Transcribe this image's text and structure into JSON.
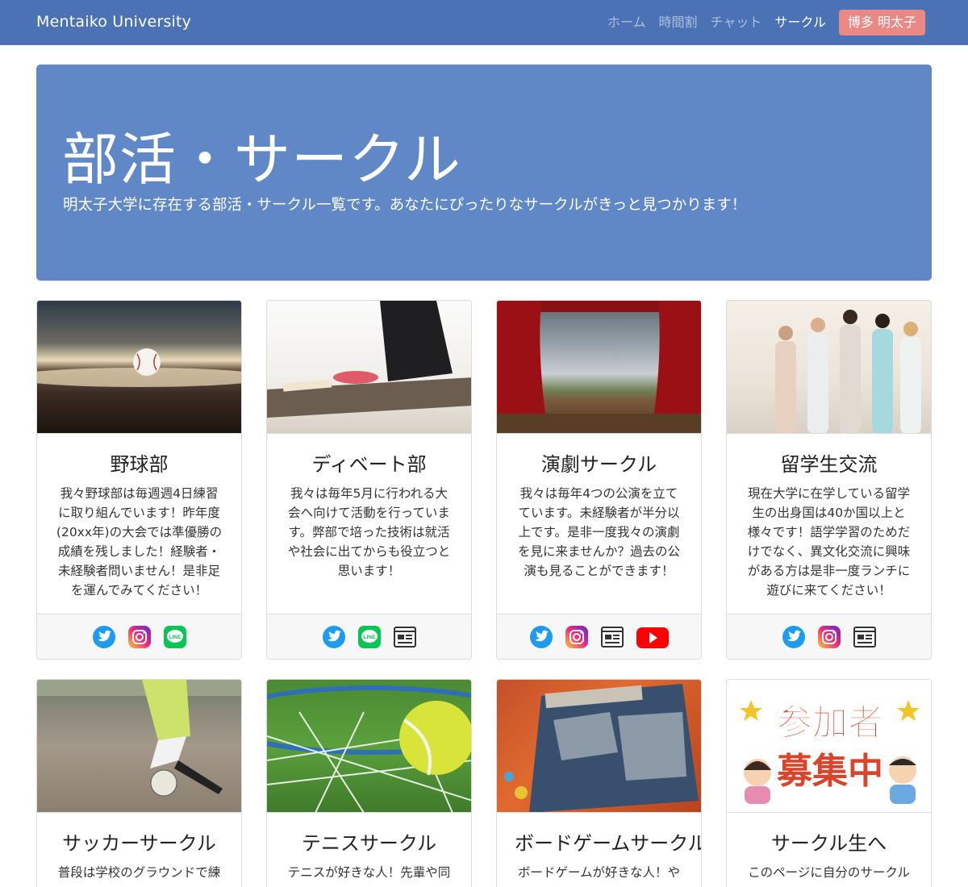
{
  "navbar": {
    "brand": "Mentaiko University",
    "links": [
      {
        "label": "ホーム",
        "active": false
      },
      {
        "label": "時間割",
        "active": false
      },
      {
        "label": "チャット",
        "active": false
      },
      {
        "label": "サークル",
        "active": true
      }
    ],
    "user_button": "博多 明太子"
  },
  "jumbotron": {
    "title": "部活・サークル",
    "lead": "明太子大学に存在する部活・サークル一覧です。あなたにぴったりなサークルがきっと見つかります！"
  },
  "cards": [
    {
      "title": "野球部",
      "text": "我々野球部は毎週週4日練習に取り組んでいます！昨年度(20xx年)の大会では準優勝の成績を残しました！経験者・未経験者問いません！是非足を運んでみてください！",
      "links": [
        "twitter-icon",
        "instagram-icon",
        "line-icon"
      ]
    },
    {
      "title": "ディベート部",
      "text": "我々は毎年5月に行われる大会へ向けて活動を行っています。弊部で培った技術は就活や社会に出てからも役立つと思います！",
      "links": [
        "twitter-icon",
        "line-icon",
        "website-icon"
      ]
    },
    {
      "title": "演劇サークル",
      "text": "我々は毎年4つの公演を立てています。未経験者が半分以上です。是非一度我々の演劇を見に来ませんか？過去の公演も見ることができます！",
      "links": [
        "twitter-icon",
        "instagram-icon",
        "website-icon",
        "youtube-icon"
      ]
    },
    {
      "title": "留学生交流",
      "text": "現在大学に在学している留学生の出身国は40か国以上と様々です！語学学習のためだけでなく、異文化交流に興味がある方は是非一度ランチに遊びに来てください！",
      "links": [
        "twitter-icon",
        "instagram-icon",
        "website-icon"
      ]
    },
    {
      "title": "サッカーサークル",
      "text": "普段は学校のグラウンドで練"
    },
    {
      "title": "テニスサークル",
      "text": "テニスが好きな人！先輩や同"
    },
    {
      "title": "ボードゲームサークル",
      "text": "ボードゲームが好きな人！や"
    },
    {
      "title": "サークル生へ",
      "text": "このページに自分のサークル"
    }
  ],
  "recruit_image": {
    "line1": "参加者",
    "line2": "募集中"
  },
  "colors": {
    "navbar": "#4a72b5",
    "jumbotron": "#6088c6",
    "user_button": "#ea8983",
    "twitter": "#1d9bf0",
    "line": "#06c755",
    "youtube": "#ff0000"
  }
}
